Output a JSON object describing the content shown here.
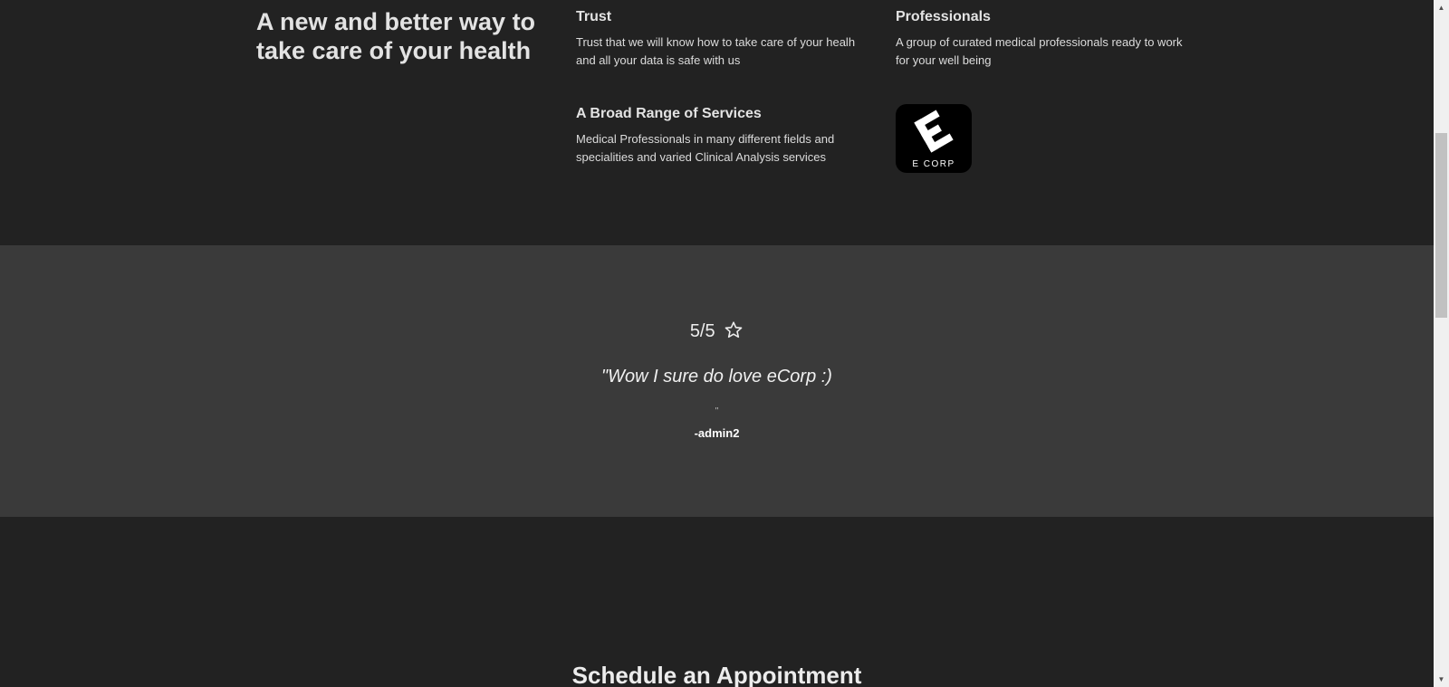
{
  "features": {
    "hero_title": "A new and better way to take care of your health",
    "items": [
      {
        "title": "Trust",
        "text": "Trust that we will know how to take care of your healh and all your data is safe with us"
      },
      {
        "title": "Professionals",
        "text": "A group of curated medical professionals ready to work for your well being"
      },
      {
        "title": "A Broad Range of Services",
        "text": "Medical Professionals in many different fields and specialities and varied Clinical Analysis services"
      }
    ],
    "logo_text": "E CORP"
  },
  "testimonial": {
    "rating": "5/5",
    "rating_icon": "star-outline-icon",
    "quote": "\"Wow I sure do love eCorp :)",
    "closing_quote": "\"",
    "author": "-admin2"
  },
  "appointment": {
    "title": "Schedule an Appointment"
  },
  "colors": {
    "background": "#222222",
    "testimonial_background": "#3a3a3a",
    "text": "#e6e6e6",
    "logo_background": "#000000"
  }
}
